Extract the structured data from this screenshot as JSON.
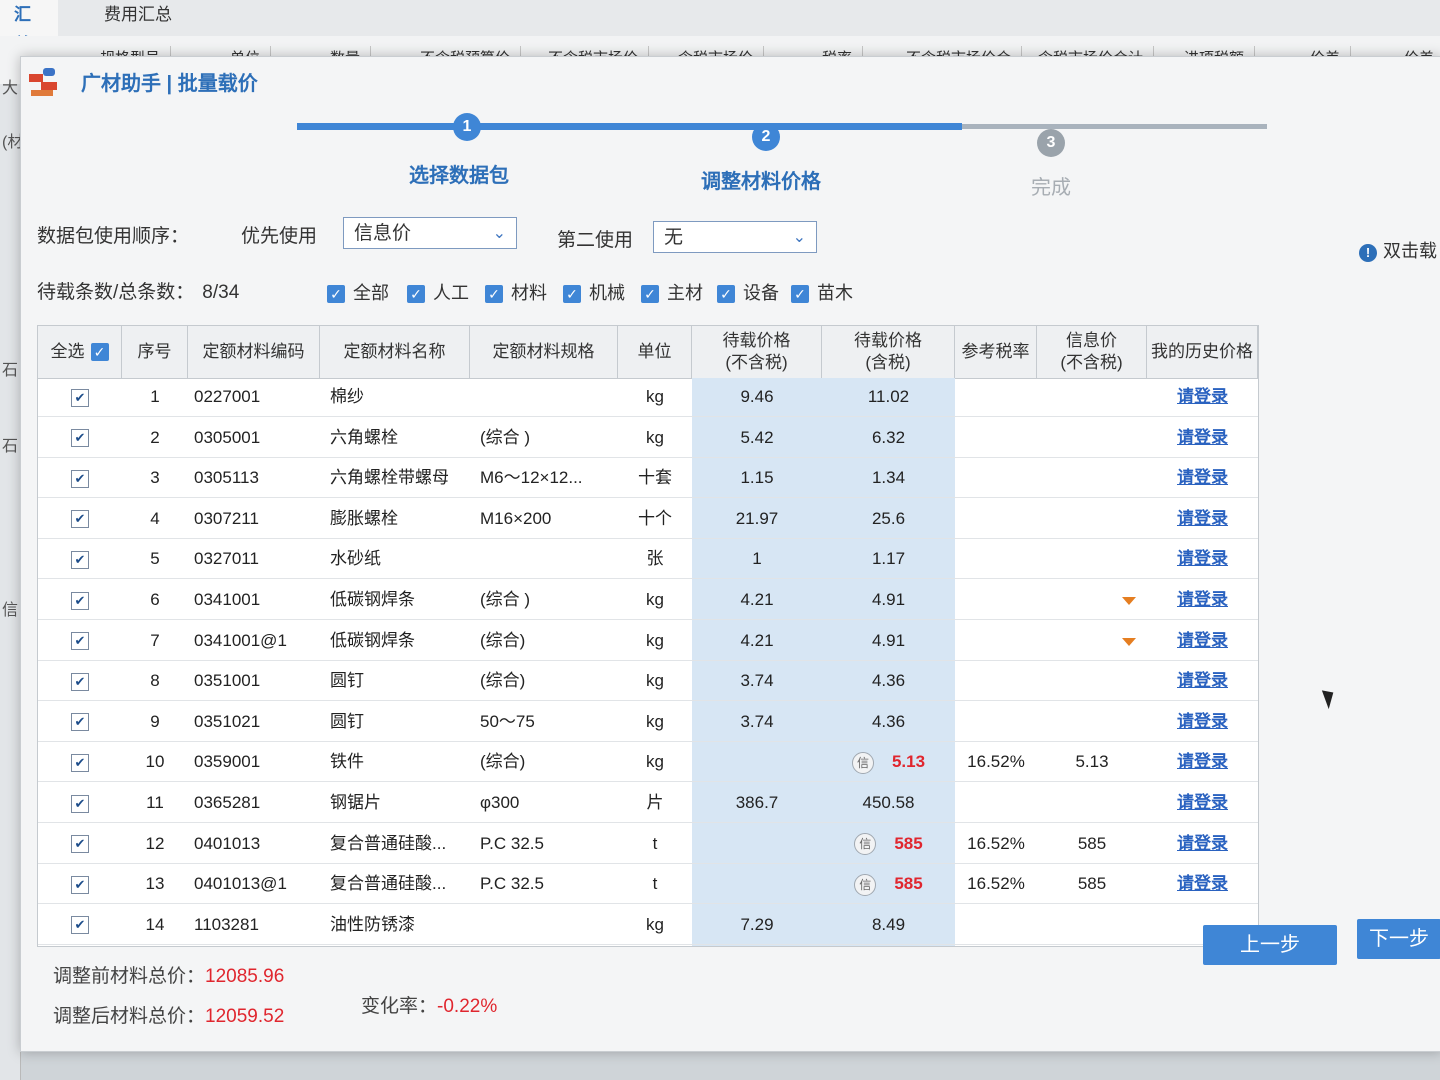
{
  "background": {
    "active_tab": "汇总",
    "other_tab": "费用汇总",
    "columns": [
      "规格型号",
      "单位",
      "数量",
      "不含税预算价",
      "不含税市场价",
      "含税市场价",
      "税率",
      "不含税市场价合",
      "含税市场价合计",
      "进项税额",
      "价差",
      "价差"
    ],
    "left_fragments": [
      "大",
      "(材",
      "石",
      "石",
      "信"
    ]
  },
  "dialog": {
    "title": "广材助手 | 批量载价",
    "steps": [
      {
        "number": "1",
        "label": "选择数据包",
        "state": "done"
      },
      {
        "number": "2",
        "label": "调整材料价格",
        "state": "done"
      },
      {
        "number": "3",
        "label": "完成",
        "state": "todo"
      }
    ],
    "order_label": "数据包使用顺序：",
    "first_label": "优先使用",
    "first_value": "信息价",
    "second_label": "第二使用",
    "second_value": "无",
    "hint": "双击载",
    "count_label": "待载条数/总条数：",
    "count_value": "8/34",
    "filters": [
      "全部",
      "人工",
      "材料",
      "机械",
      "主材",
      "设备",
      "苗木"
    ],
    "table": {
      "headers": {
        "select_all": "全选",
        "seq": "序号",
        "code": "定额材料编码",
        "name": "定额材料名称",
        "spec": "定额材料规格",
        "unit": "单位",
        "price_ex": "待载价格\n(不含税)",
        "price_in": "待载价格\n(含税)",
        "tax": "参考税率",
        "info": "信息价\n(不含税)",
        "history": "我的历史价格"
      },
      "rows": [
        {
          "seq": "1",
          "code": "0227001",
          "name": "棉纱",
          "spec": "",
          "unit": "kg",
          "price_ex": "9.46",
          "price_in": "11.02",
          "badge": "",
          "tax": "",
          "info": "",
          "history": "请登录",
          "flag": false
        },
        {
          "seq": "2",
          "code": "0305001",
          "name": "六角螺栓",
          "spec": "(综合 )",
          "unit": "kg",
          "price_ex": "5.42",
          "price_in": "6.32",
          "badge": "",
          "tax": "",
          "info": "",
          "history": "请登录",
          "flag": false
        },
        {
          "seq": "3",
          "code": "0305113",
          "name": "六角螺栓带螺母",
          "spec": "M6～12×12...",
          "unit": "十套",
          "price_ex": "1.15",
          "price_in": "1.34",
          "badge": "",
          "tax": "",
          "info": "",
          "history": "请登录",
          "flag": false
        },
        {
          "seq": "4",
          "code": "0307211",
          "name": "膨胀螺栓",
          "spec": "M16×200",
          "unit": "十个",
          "price_ex": "21.97",
          "price_in": "25.6",
          "badge": "",
          "tax": "",
          "info": "",
          "history": "请登录",
          "flag": false
        },
        {
          "seq": "5",
          "code": "0327011",
          "name": "水砂纸",
          "spec": "",
          "unit": "张",
          "price_ex": "1",
          "price_in": "1.17",
          "badge": "",
          "tax": "",
          "info": "",
          "history": "请登录",
          "flag": false
        },
        {
          "seq": "6",
          "code": "0341001",
          "name": "低碳钢焊条",
          "spec": "(综合 )",
          "unit": "kg",
          "price_ex": "4.21",
          "price_in": "4.91",
          "badge": "",
          "tax": "",
          "info": "",
          "history": "请登录",
          "flag": true
        },
        {
          "seq": "7",
          "code": "0341001@1",
          "name": "低碳钢焊条",
          "spec": "(综合)",
          "unit": "kg",
          "price_ex": "4.21",
          "price_in": "4.91",
          "badge": "",
          "tax": "",
          "info": "",
          "history": "请登录",
          "flag": true
        },
        {
          "seq": "8",
          "code": "0351001",
          "name": "圆钉",
          "spec": "(综合)",
          "unit": "kg",
          "price_ex": "3.74",
          "price_in": "4.36",
          "badge": "",
          "tax": "",
          "info": "",
          "history": "请登录",
          "flag": false
        },
        {
          "seq": "9",
          "code": "0351021",
          "name": "圆钉",
          "spec": "50～75",
          "unit": "kg",
          "price_ex": "3.74",
          "price_in": "4.36",
          "badge": "",
          "tax": "",
          "info": "",
          "history": "请登录",
          "flag": false
        },
        {
          "seq": "10",
          "code": "0359001",
          "name": "铁件",
          "spec": "(综合)",
          "unit": "kg",
          "price_ex": "",
          "price_in": "5.13",
          "badge": "信",
          "tax": "16.52%",
          "info": "5.13",
          "history": "请登录",
          "flag": false
        },
        {
          "seq": "11",
          "code": "0365281",
          "name": "钢锯片",
          "spec": "φ300",
          "unit": "片",
          "price_ex": "386.7",
          "price_in": "450.58",
          "badge": "",
          "tax": "",
          "info": "",
          "history": "请登录",
          "flag": false
        },
        {
          "seq": "12",
          "code": "0401013",
          "name": "复合普通硅酸...",
          "spec": "P.C 32.5",
          "unit": "t",
          "price_ex": "",
          "price_in": "585",
          "badge": "信",
          "tax": "16.52%",
          "info": "585",
          "history": "请登录",
          "flag": false
        },
        {
          "seq": "13",
          "code": "0401013@1",
          "name": "复合普通硅酸...",
          "spec": "P.C 32.5",
          "unit": "t",
          "price_ex": "",
          "price_in": "585",
          "badge": "信",
          "tax": "16.52%",
          "info": "585",
          "history": "请登录",
          "flag": false
        },
        {
          "seq": "14",
          "code": "1103281",
          "name": "油性防锈漆",
          "spec": "",
          "unit": "kg",
          "price_ex": "7.29",
          "price_in": "8.49",
          "badge": "",
          "tax": "",
          "info": "",
          "history": "",
          "flag": false
        }
      ]
    },
    "summary": {
      "before_label": "调整前材料总价：",
      "before_value": "12085.96",
      "after_label": "调整后材料总价：",
      "after_value": "12059.52",
      "change_label": "变化率：",
      "change_value": "-0.22%"
    },
    "buttons": {
      "prev": "上一步",
      "next": "下一步"
    }
  }
}
